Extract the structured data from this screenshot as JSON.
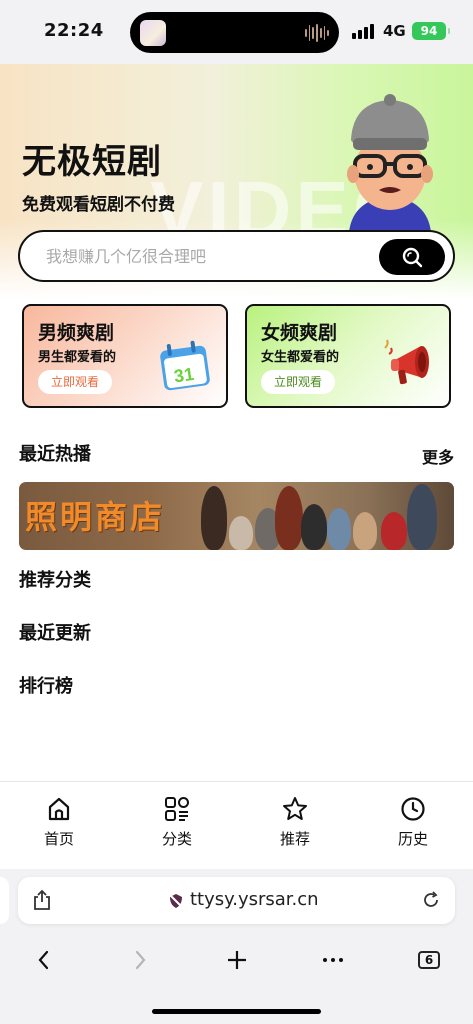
{
  "status_bar": {
    "time": "22:24",
    "network": "4G",
    "battery": "94"
  },
  "hero": {
    "title": "无极短剧",
    "subtitle": "免费观看短剧不付费",
    "watermark": "VIDEO"
  },
  "search": {
    "placeholder": "我想赚几个亿很合理吧",
    "icon": "search-icon"
  },
  "categories": [
    {
      "title": "男频爽剧",
      "subtitle": "男生都爱看的",
      "button": "立即观看",
      "icon": "calendar-icon",
      "accent": "#f8b89e"
    },
    {
      "title": "女频爽剧",
      "subtitle": "女生都爱看的",
      "button": "立即观看",
      "icon": "megaphone-icon",
      "accent": "#b9f27f"
    }
  ],
  "calendar_day": "31",
  "sections": {
    "recent_hot": "最近热播",
    "more": "更多",
    "recommend_category": "推荐分类",
    "recent_update": "最近更新",
    "ranking": "排行榜"
  },
  "banner": {
    "title": "照明商店"
  },
  "tabbar": [
    {
      "label": "首页",
      "icon": "home-icon"
    },
    {
      "label": "分类",
      "icon": "category-grid-icon"
    },
    {
      "label": "推荐",
      "icon": "star-icon"
    },
    {
      "label": "历史",
      "icon": "clock-icon"
    }
  ],
  "browser": {
    "domain": "ttysy.ysrsar.cn",
    "tab_count": "6"
  },
  "colors": {
    "accent_dark": "#000000",
    "male_accent": "#e86a3e",
    "female_accent": "#4d8a1e"
  }
}
